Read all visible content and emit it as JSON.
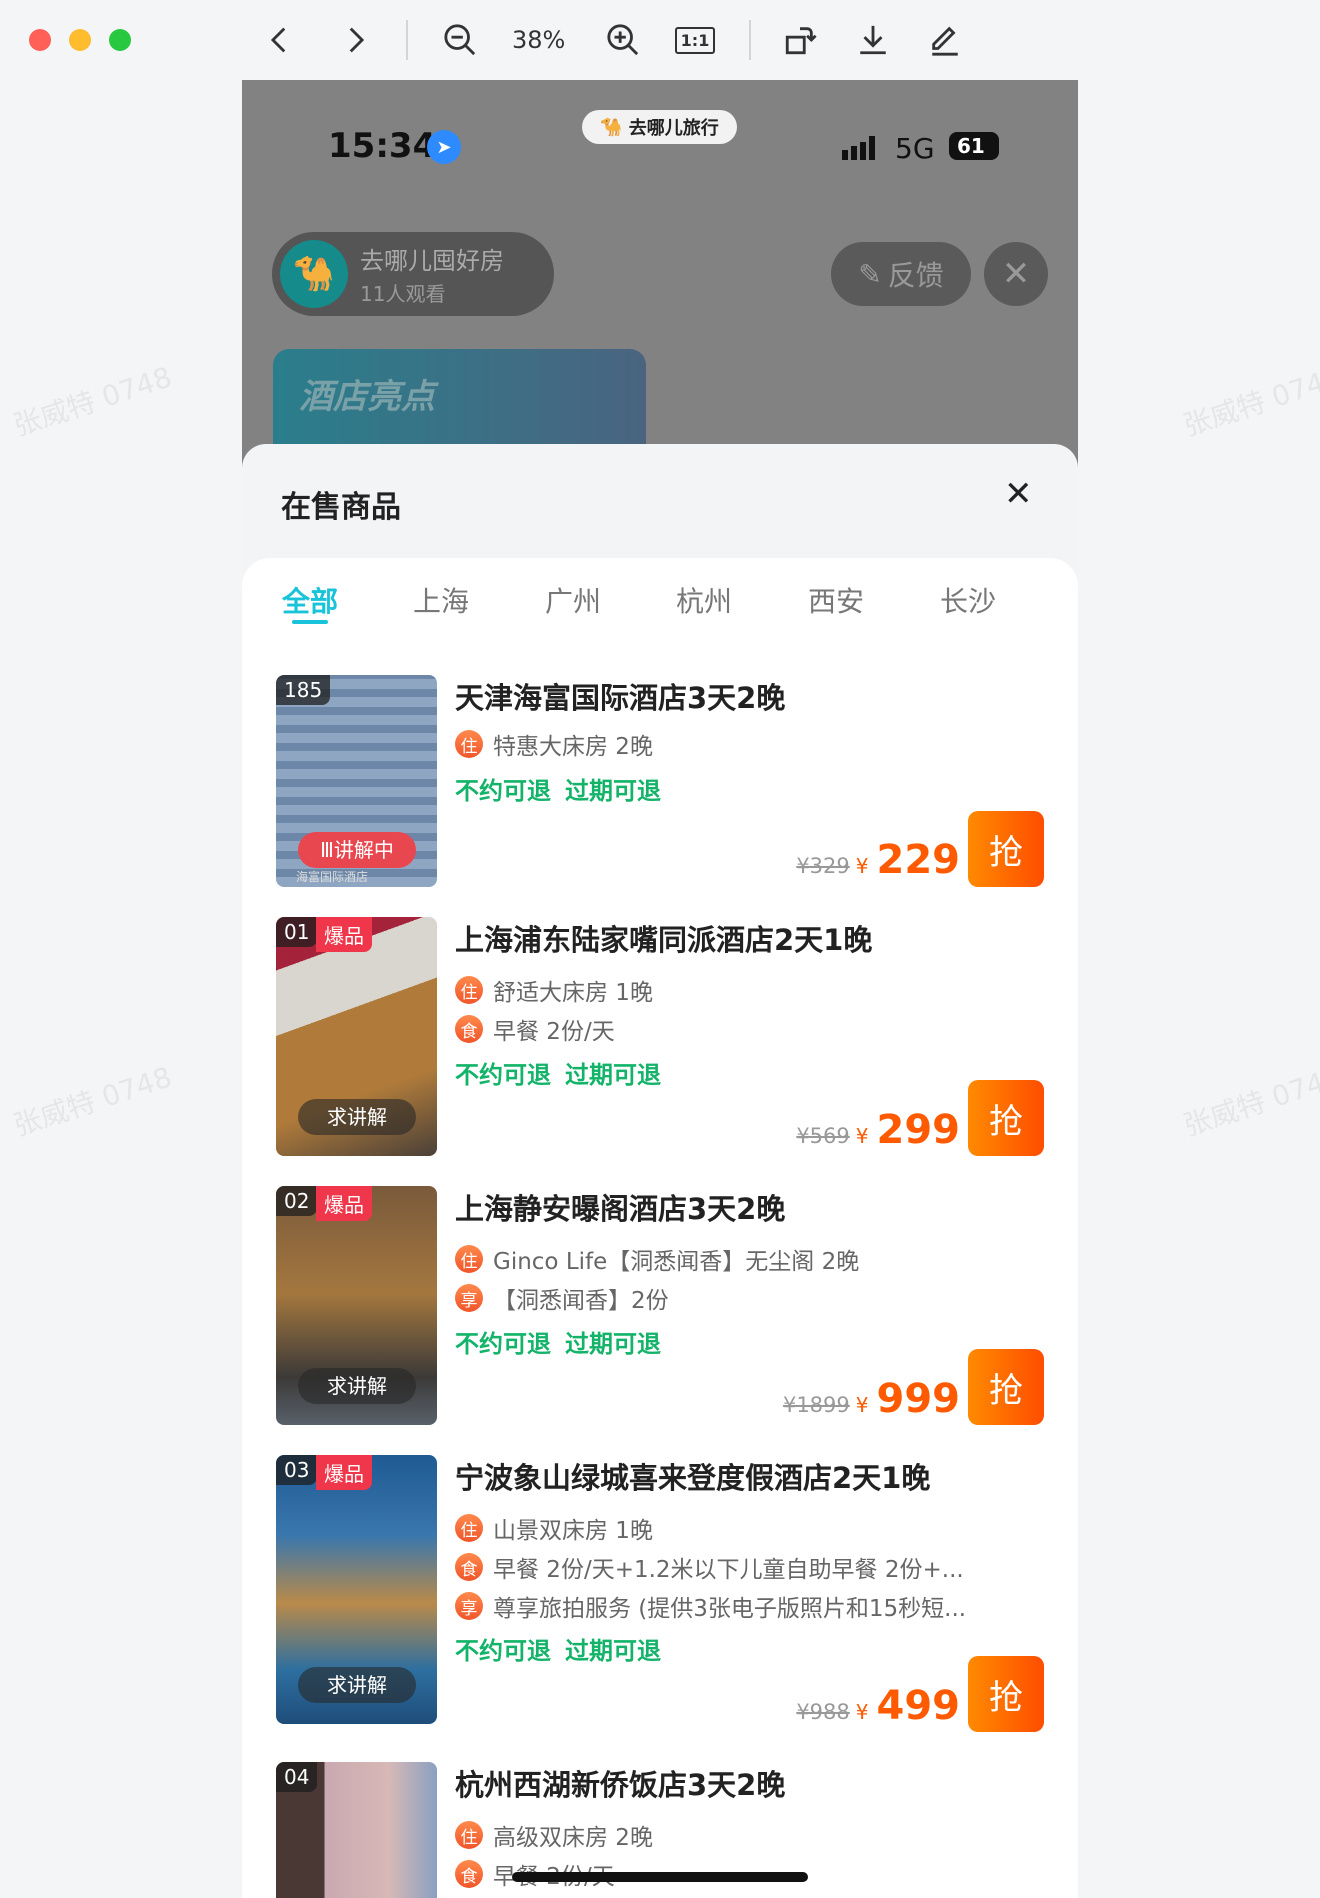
{
  "toolbar": {
    "zoom_level": "38%",
    "actual_size_label": "1:1"
  },
  "status_bar": {
    "time": "15:34",
    "app_badge": "去哪儿旅行",
    "network": "5G",
    "battery": "61"
  },
  "live": {
    "room_name": "去哪儿囤好房",
    "viewers": "11人观看",
    "feedback_label": "反馈",
    "highlight_card": "酒店亮点"
  },
  "sheet": {
    "title": "在售商品",
    "tabs": [
      "全部",
      "上海",
      "广州",
      "杭州",
      "西安",
      "长沙"
    ]
  },
  "watermark": "张威特 0748",
  "items": [
    {
      "rank": "185",
      "hot": "",
      "badge": "讲解中",
      "title": "天津海富国际酒店3天2晚",
      "features": [
        {
          "icon": "住",
          "text": "特惠大床房 2晚"
        }
      ],
      "policies": [
        "不约可退",
        "过期可退"
      ],
      "original_price": "¥329",
      "currency": "¥",
      "price": "229",
      "button": "抢",
      "photo_text": "海富国际酒店"
    },
    {
      "rank": "01",
      "hot": "爆品",
      "badge": "求讲解",
      "title": "上海浦东陆家嘴同派酒店2天1晚",
      "features": [
        {
          "icon": "住",
          "text": "舒适大床房 1晚"
        },
        {
          "icon": "食",
          "text": "早餐 2份/天"
        }
      ],
      "policies": [
        "不约可退",
        "过期可退"
      ],
      "original_price": "¥569",
      "currency": "¥",
      "price": "299",
      "button": "抢"
    },
    {
      "rank": "02",
      "hot": "爆品",
      "badge": "求讲解",
      "title": "上海静安曝阁酒店3天2晚",
      "features": [
        {
          "icon": "住",
          "text": "Ginco Life【洞悉闻香】无尘阁 2晚"
        },
        {
          "icon": "享",
          "text": "【洞悉闻香】2份"
        }
      ],
      "policies": [
        "不约可退",
        "过期可退"
      ],
      "original_price": "¥1899",
      "currency": "¥",
      "price": "999",
      "button": "抢"
    },
    {
      "rank": "03",
      "hot": "爆品",
      "badge": "求讲解",
      "title": "宁波象山绿城喜来登度假酒店2天1晚",
      "features": [
        {
          "icon": "住",
          "text": "山景双床房 1晚"
        },
        {
          "icon": "食",
          "text": "早餐 2份/天+1.2米以下儿童自助早餐 2份+..."
        },
        {
          "icon": "享",
          "text": "尊享旅拍服务 (提供3张电子版照片和15秒短..."
        }
      ],
      "policies": [
        "不约可退",
        "过期可退"
      ],
      "original_price": "¥988",
      "currency": "¥",
      "price": "499",
      "button": "抢"
    },
    {
      "rank": "04",
      "title": "杭州西湖新侨饭店3天2晚",
      "features": [
        {
          "icon": "住",
          "text": "高级双床房 2晚"
        },
        {
          "icon": "食",
          "text": "早餐 2份/天"
        }
      ]
    }
  ]
}
